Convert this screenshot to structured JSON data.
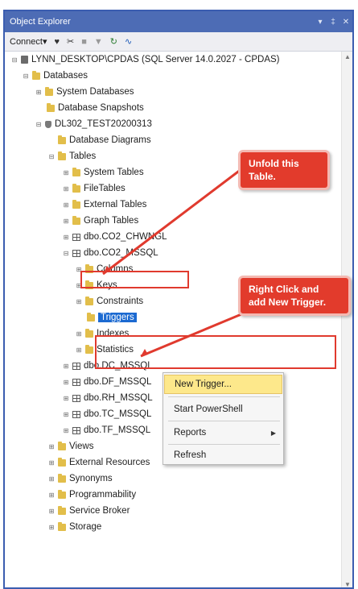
{
  "panel": {
    "title": "Object Explorer",
    "title_controls": [
      "▾",
      "‡",
      "✕"
    ]
  },
  "toolbar": {
    "connect_label": "Connect▾",
    "icons": [
      "connect-object-icon",
      "disconnect-icon",
      "stop-icon",
      "filter-icon",
      "refresh-icon",
      "activity-monitor-icon"
    ]
  },
  "tree": {
    "server": "LYNN_DESKTOP\\CPDAS (SQL Server 14.0.2027 - CPDAS)",
    "databases": "Databases",
    "system_databases": "System Databases",
    "database_snapshots": "Database Snapshots",
    "db_name": "DL302_TEST20200313",
    "database_diagrams": "Database Diagrams",
    "tables": "Tables",
    "system_tables": "System Tables",
    "file_tables": "FileTables",
    "external_tables": "External Tables",
    "graph_tables": "Graph Tables",
    "t_co2_chwngl": "dbo.CO2_CHWNGL",
    "t_co2_mssql": "dbo.CO2_MSSQL",
    "columns": "Columns",
    "keys": "Keys",
    "constraints": "Constraints",
    "triggers": "Triggers",
    "indexes": "Indexes",
    "statistics": "Statistics",
    "t_dc": "dbo.DC_MSSQL",
    "t_df": "dbo.DF_MSSQL",
    "t_rh": "dbo.RH_MSSQL",
    "t_tc": "dbo.TC_MSSQL",
    "t_tf": "dbo.TF_MSSQL",
    "views": "Views",
    "external_resources": "External Resources",
    "synonyms": "Synonyms",
    "programmability": "Programmability",
    "service_broker": "Service Broker",
    "storage": "Storage"
  },
  "context_menu": {
    "new_trigger": "New Trigger...",
    "start_powershell": "Start PowerShell",
    "reports": "Reports",
    "refresh": "Refresh"
  },
  "annotations": {
    "callout1": "Unfold this\nTable.",
    "callout2": "Right Click and\nadd New Trigger.",
    "color": "#e23b2c"
  },
  "colors": {
    "titlebar": "#4d6cb5",
    "selection": "#1c6ad1",
    "menu_highlight": "#fde88b",
    "folder": "#e2be4a"
  }
}
